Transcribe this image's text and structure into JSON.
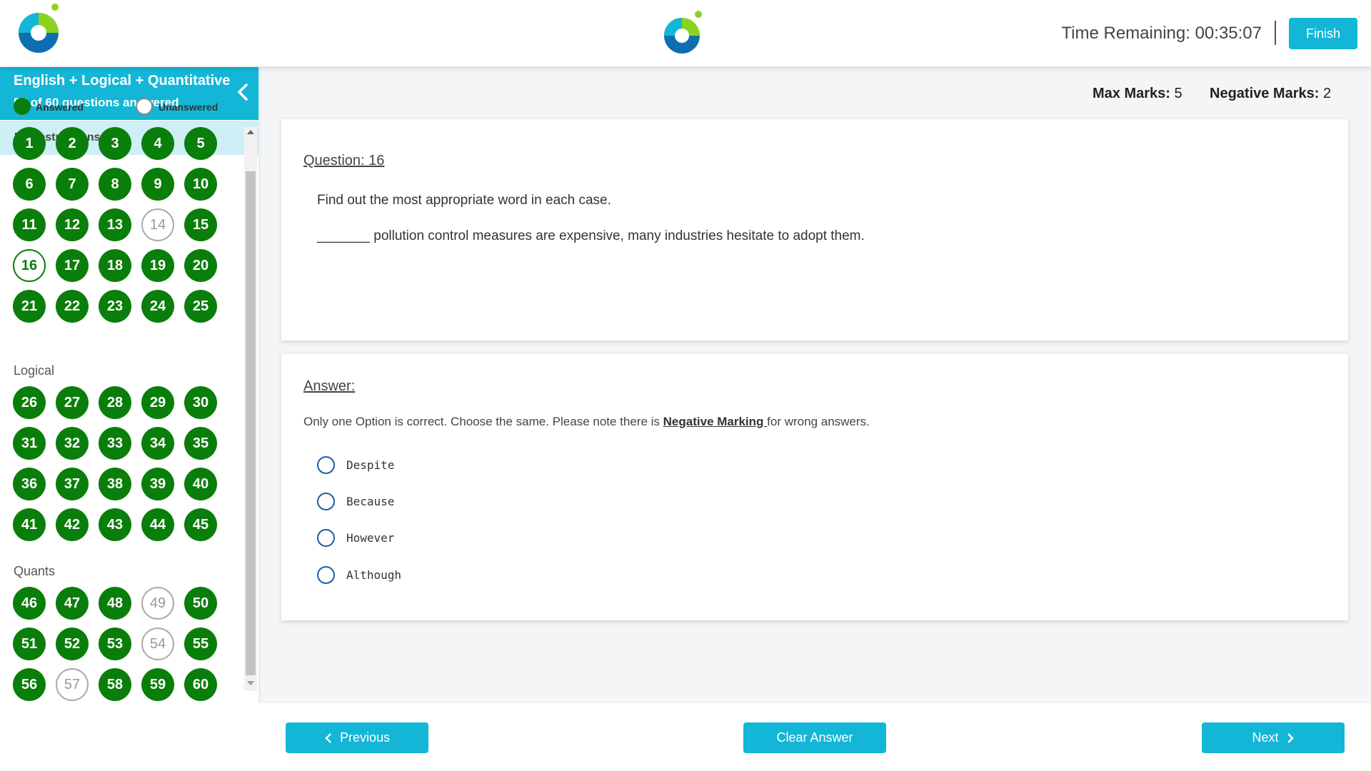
{
  "header": {
    "timer_label": "Time Remaining:",
    "timer_value": "00:35:07",
    "finish_label": "Finish"
  },
  "sidebar": {
    "section_title": "English + Logical + Quantitative",
    "section_sub": "55 of 60 questions answered",
    "instructions_label": "Instructions",
    "legend": {
      "answered": "Answered",
      "unanswered": "Unanswered"
    },
    "groups": [
      {
        "label": "",
        "questions": [
          {
            "n": "1",
            "s": "answered"
          },
          {
            "n": "2",
            "s": "answered"
          },
          {
            "n": "3",
            "s": "answered"
          },
          {
            "n": "4",
            "s": "answered"
          },
          {
            "n": "5",
            "s": "answered"
          },
          {
            "n": "6",
            "s": "answered"
          },
          {
            "n": "7",
            "s": "answered"
          },
          {
            "n": "8",
            "s": "answered"
          },
          {
            "n": "9",
            "s": "answered"
          },
          {
            "n": "10",
            "s": "answered"
          },
          {
            "n": "11",
            "s": "answered"
          },
          {
            "n": "12",
            "s": "answered"
          },
          {
            "n": "13",
            "s": "answered"
          },
          {
            "n": "14",
            "s": "unanswered"
          },
          {
            "n": "15",
            "s": "answered"
          },
          {
            "n": "16",
            "s": "current"
          },
          {
            "n": "17",
            "s": "answered"
          },
          {
            "n": "18",
            "s": "answered"
          },
          {
            "n": "19",
            "s": "answered"
          },
          {
            "n": "20",
            "s": "answered"
          },
          {
            "n": "21",
            "s": "answered"
          },
          {
            "n": "22",
            "s": "answered"
          },
          {
            "n": "23",
            "s": "answered"
          },
          {
            "n": "24",
            "s": "answered"
          },
          {
            "n": "25",
            "s": "answered"
          }
        ]
      },
      {
        "label": "Logical",
        "questions": [
          {
            "n": "26",
            "s": "answered"
          },
          {
            "n": "27",
            "s": "answered"
          },
          {
            "n": "28",
            "s": "answered"
          },
          {
            "n": "29",
            "s": "answered"
          },
          {
            "n": "30",
            "s": "answered"
          },
          {
            "n": "31",
            "s": "answered"
          },
          {
            "n": "32",
            "s": "answered"
          },
          {
            "n": "33",
            "s": "answered"
          },
          {
            "n": "34",
            "s": "answered"
          },
          {
            "n": "35",
            "s": "answered"
          },
          {
            "n": "36",
            "s": "answered"
          },
          {
            "n": "37",
            "s": "answered"
          },
          {
            "n": "38",
            "s": "answered"
          },
          {
            "n": "39",
            "s": "answered"
          },
          {
            "n": "40",
            "s": "answered"
          },
          {
            "n": "41",
            "s": "answered"
          },
          {
            "n": "42",
            "s": "answered"
          },
          {
            "n": "43",
            "s": "answered"
          },
          {
            "n": "44",
            "s": "answered"
          },
          {
            "n": "45",
            "s": "answered"
          }
        ]
      },
      {
        "label": "Quants",
        "questions": [
          {
            "n": "46",
            "s": "answered"
          },
          {
            "n": "47",
            "s": "answered"
          },
          {
            "n": "48",
            "s": "answered"
          },
          {
            "n": "49",
            "s": "unanswered"
          },
          {
            "n": "50",
            "s": "answered"
          },
          {
            "n": "51",
            "s": "answered"
          },
          {
            "n": "52",
            "s": "answered"
          },
          {
            "n": "53",
            "s": "answered"
          },
          {
            "n": "54",
            "s": "unanswered"
          },
          {
            "n": "55",
            "s": "answered"
          },
          {
            "n": "56",
            "s": "answered"
          },
          {
            "n": "57",
            "s": "unanswered"
          },
          {
            "n": "58",
            "s": "answered"
          },
          {
            "n": "59",
            "s": "answered"
          },
          {
            "n": "60",
            "s": "answered"
          }
        ]
      }
    ]
  },
  "marks": {
    "max_label": "Max Marks:",
    "max_value": "5",
    "neg_label": "Negative Marks:",
    "neg_value": "2"
  },
  "question": {
    "title": "Question: 16",
    "prompt": "Find out the most appropriate word in each case.",
    "sentence": "_______ pollution control measures are expensive, many industries hesitate to adopt them."
  },
  "answer": {
    "title": "Answer:",
    "instruction_pre": "Only one Option is correct. Choose the same. Please note there is ",
    "instruction_bold": "Negative Marking ",
    "instruction_post": "for wrong answers.",
    "options": [
      "Despite",
      "Because",
      "However",
      "Although"
    ]
  },
  "footer": {
    "previous_label": "Previous",
    "clear_label": "Clear Answer",
    "next_label": "Next"
  },
  "colors": {
    "accent": "#13b6d6",
    "answered": "#0a7e0a",
    "radio": "#1d5fa3"
  }
}
